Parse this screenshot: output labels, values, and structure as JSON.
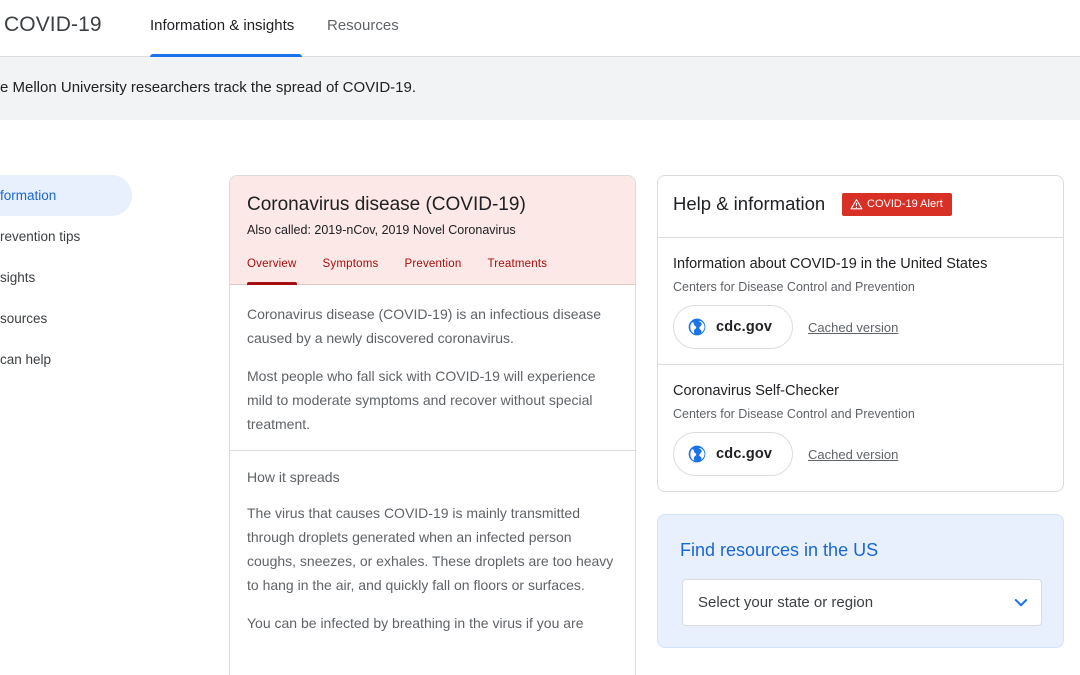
{
  "header": {
    "brand": "COVID-19",
    "tabs": [
      {
        "label": "Information & insights",
        "active": true
      },
      {
        "label": "Resources",
        "active": false
      }
    ]
  },
  "banner": {
    "text": "e Mellon University researchers track the spread of COVID-19."
  },
  "sidebar": {
    "items": [
      {
        "label": "formation",
        "active": true
      },
      {
        "label": "revention tips"
      },
      {
        "label": "sights"
      },
      {
        "label": "sources"
      },
      {
        "label": "can help"
      }
    ]
  },
  "main_card": {
    "title": "Coronavirus disease (COVID-19)",
    "subtitle": "Also called: 2019-nCov, 2019 Novel Coronavirus",
    "tabs": [
      "Overview",
      "Symptoms",
      "Prevention",
      "Treatments"
    ],
    "paragraphs": [
      "Coronavirus disease (COVID-19) is an infectious disease caused by a newly discovered coronavirus.",
      "Most people who fall sick with COVID-19 will experience mild to moderate symptoms and recover without special treatment."
    ],
    "section_title": "How it spreads",
    "section_paragraphs": [
      "The virus that causes COVID-19 is mainly transmitted through droplets generated when an infected person coughs, sneezes, or exhales. These droplets are too heavy to hang in the air, and quickly fall on floors or surfaces.",
      "You can be infected by breathing in the virus if you are"
    ],
    "accent_color": "#a50e0e",
    "header_bg": "#fce8e6"
  },
  "help_card": {
    "title": "Help & information",
    "alert_label": "COVID-19 Alert",
    "alert_color": "#d93025",
    "items": [
      {
        "title": "Information about COVID-19 in the United States",
        "source": "Centers for Disease Control and Prevention",
        "site": "cdc.gov",
        "cached": "Cached version"
      },
      {
        "title": "Coronavirus Self-Checker",
        "source": "Centers for Disease Control and Prevention",
        "site": "cdc.gov",
        "cached": "Cached version"
      }
    ]
  },
  "find_card": {
    "title": "Find resources in the US",
    "select_placeholder": "Select your state or region",
    "accent_color": "#1967d2"
  },
  "icons": {
    "alert": "warning-triangle-icon",
    "site": "globe-icon",
    "dropdown": "chevron-down-icon"
  }
}
